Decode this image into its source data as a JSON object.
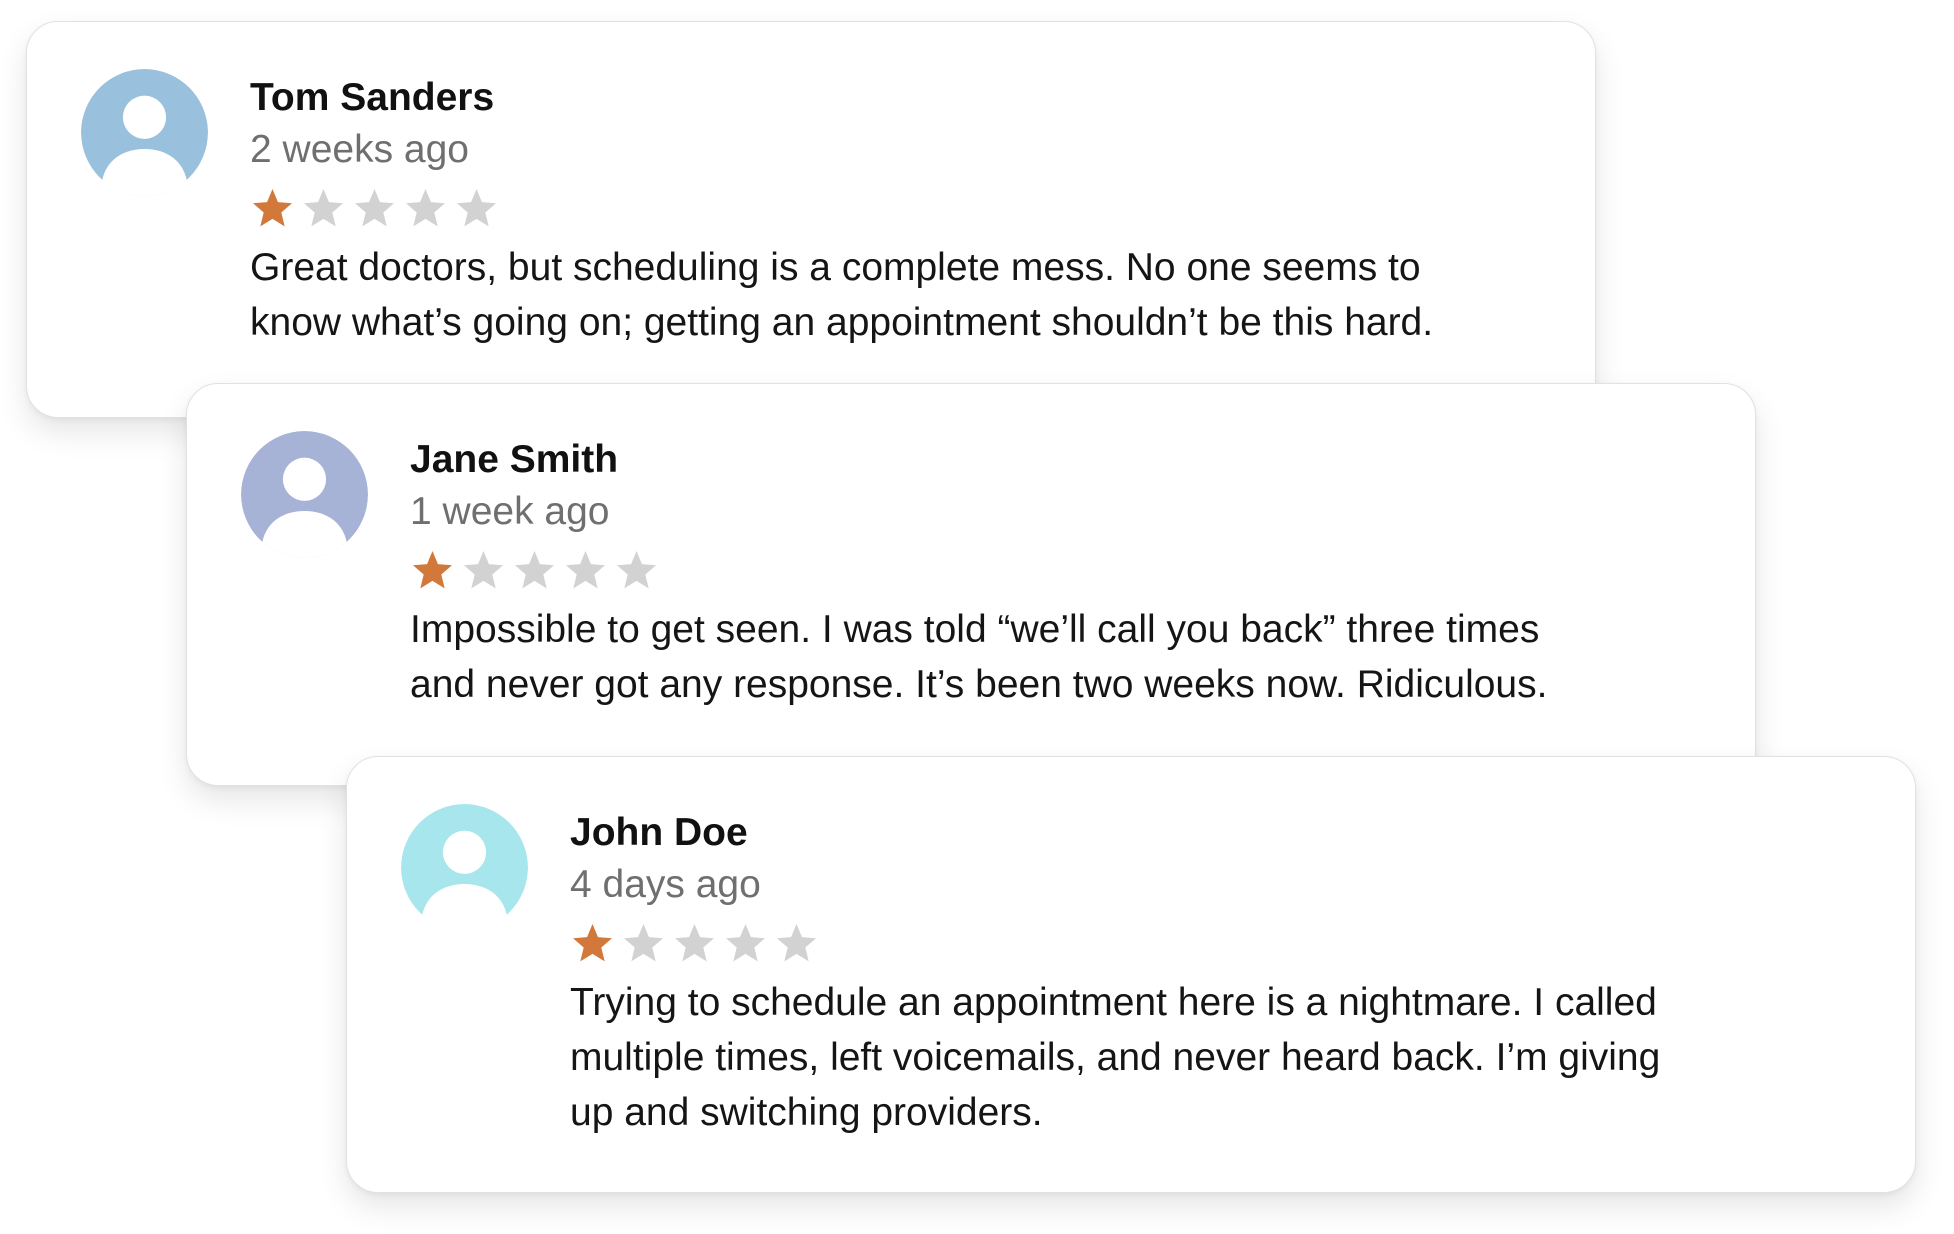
{
  "reviews": [
    {
      "name": "Tom Sanders",
      "time": "2 weeks ago",
      "rating": 1,
      "max_rating": 5,
      "avatar_color": "#99c0dc",
      "avatar_icon": "user-icon",
      "lines": [
        "Great doctors, but scheduling is a complete mess. No one seems to",
        "know what’s going on; getting an appointment shouldn’t be this hard."
      ]
    },
    {
      "name": "Jane Smith",
      "time": "1 week ago",
      "rating": 1,
      "max_rating": 5,
      "avatar_color": "#a6b2d6",
      "avatar_icon": "user-icon",
      "lines": [
        "Impossible to get seen. I was told “we’ll call you back” three times",
        "and never got any response. It’s been two weeks now. Ridiculous."
      ]
    },
    {
      "name": "John Doe",
      "time": "4 days ago",
      "rating": 1,
      "max_rating": 5,
      "avatar_color": "#a7e6ec",
      "avatar_icon": "user-icon",
      "lines": [
        "Trying to schedule an appointment here is a nightmare. I called",
        "multiple times, left voicemails, and never heard back. I’m giving",
        "up and switching providers."
      ]
    }
  ],
  "colors": {
    "star_filled": "#d2783a",
    "star_empty": "#d2d2d2"
  },
  "icons": {
    "star": "star-icon"
  }
}
